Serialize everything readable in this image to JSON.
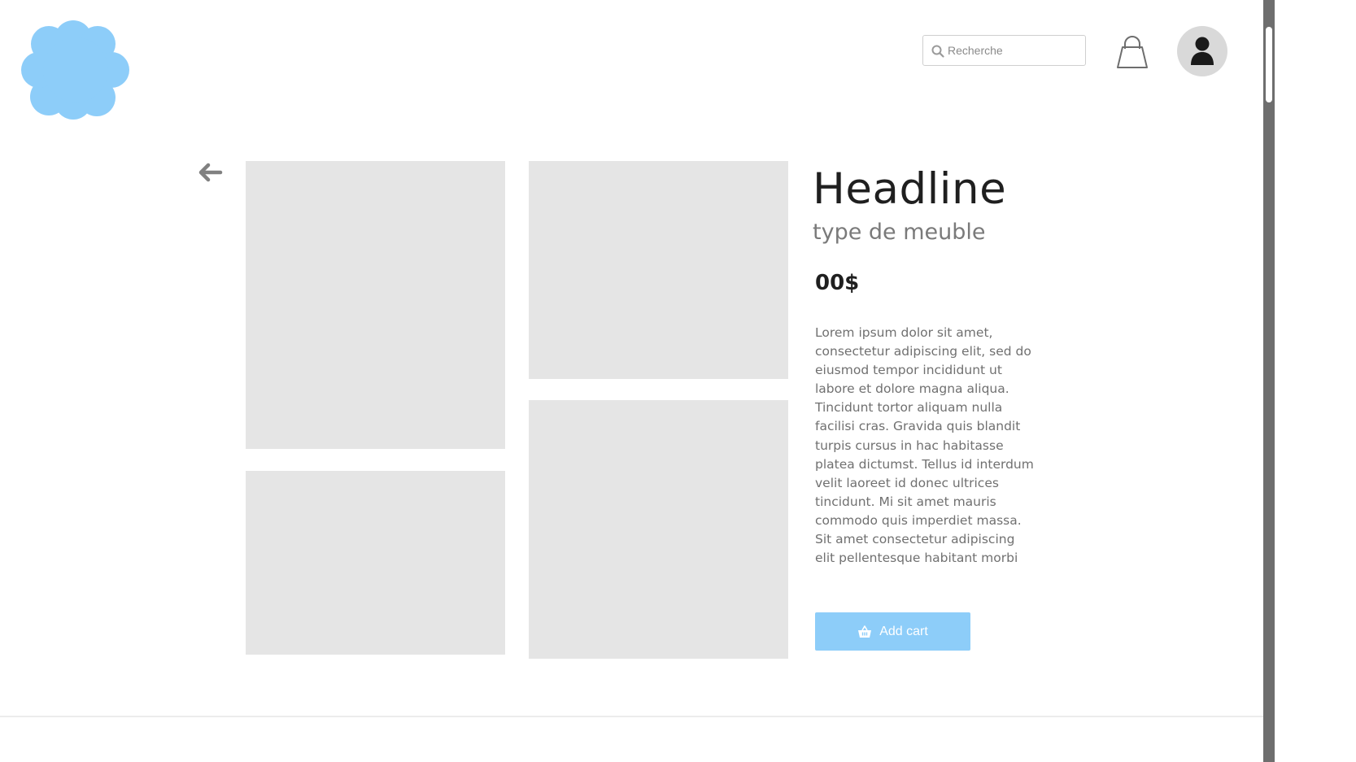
{
  "header": {
    "search": {
      "placeholder": "Recherche"
    }
  },
  "product": {
    "headline": "Headline",
    "subtitle": "type de meuble",
    "price": "00$",
    "description": "Lorem ipsum dolor sit amet, consectetur adipiscing elit, sed do eiusmod tempor incididunt ut labore et dolore magna aliqua. Tincidunt tortor aliquam nulla facilisi cras. Gravida quis blandit turpis cursus in hac habitasse platea dictumst. Tellus id interdum velit laoreet id donec ultrices tincidunt. Mi sit amet mauris commodo quis imperdiet massa. Sit amet consectetur adipiscing elit pellentesque habitant morbi",
    "add_cart_label": "Add cart"
  },
  "colors": {
    "brand": "#8dcdf9",
    "placeholder_image": "#e5e5e5",
    "avatar_bg": "#d9d9d9"
  },
  "icons": [
    "logo-cloud",
    "search-icon",
    "shopping-bag-icon",
    "user-icon",
    "back-arrow-icon",
    "basket-icon"
  ]
}
